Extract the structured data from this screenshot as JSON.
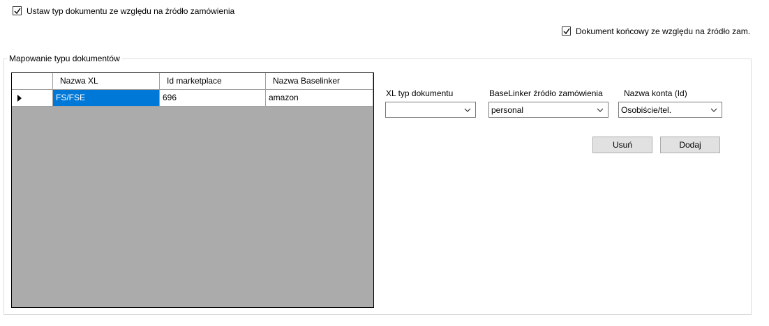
{
  "options": {
    "set_doc_type_label": "Ustaw typ dokumentu ze względu na źródło zamówienia",
    "set_doc_type_checked": true,
    "final_doc_label": "Dokument końcowy ze względu na źródło zam.",
    "final_doc_checked": true
  },
  "mapping": {
    "group_title": "Mapowanie typu dokumentów",
    "columns": [
      "Nazwa XL",
      "Id marketplace",
      "Nazwa Baselinker"
    ],
    "rows": [
      {
        "nazwa_xl": "FS/FSE",
        "id_marketplace": "696",
        "nazwa_baselinker": "amazon"
      }
    ]
  },
  "form": {
    "xl_type_label": "XL typ dokumentu",
    "xl_type_value": "",
    "source_label": "BaseLinker źródło zamówienia",
    "source_value": "personal",
    "account_label": "Nazwa konta (Id)",
    "account_value": "Osobiście/tel."
  },
  "buttons": {
    "remove_label": "Usuń",
    "add_label": "Dodaj"
  }
}
